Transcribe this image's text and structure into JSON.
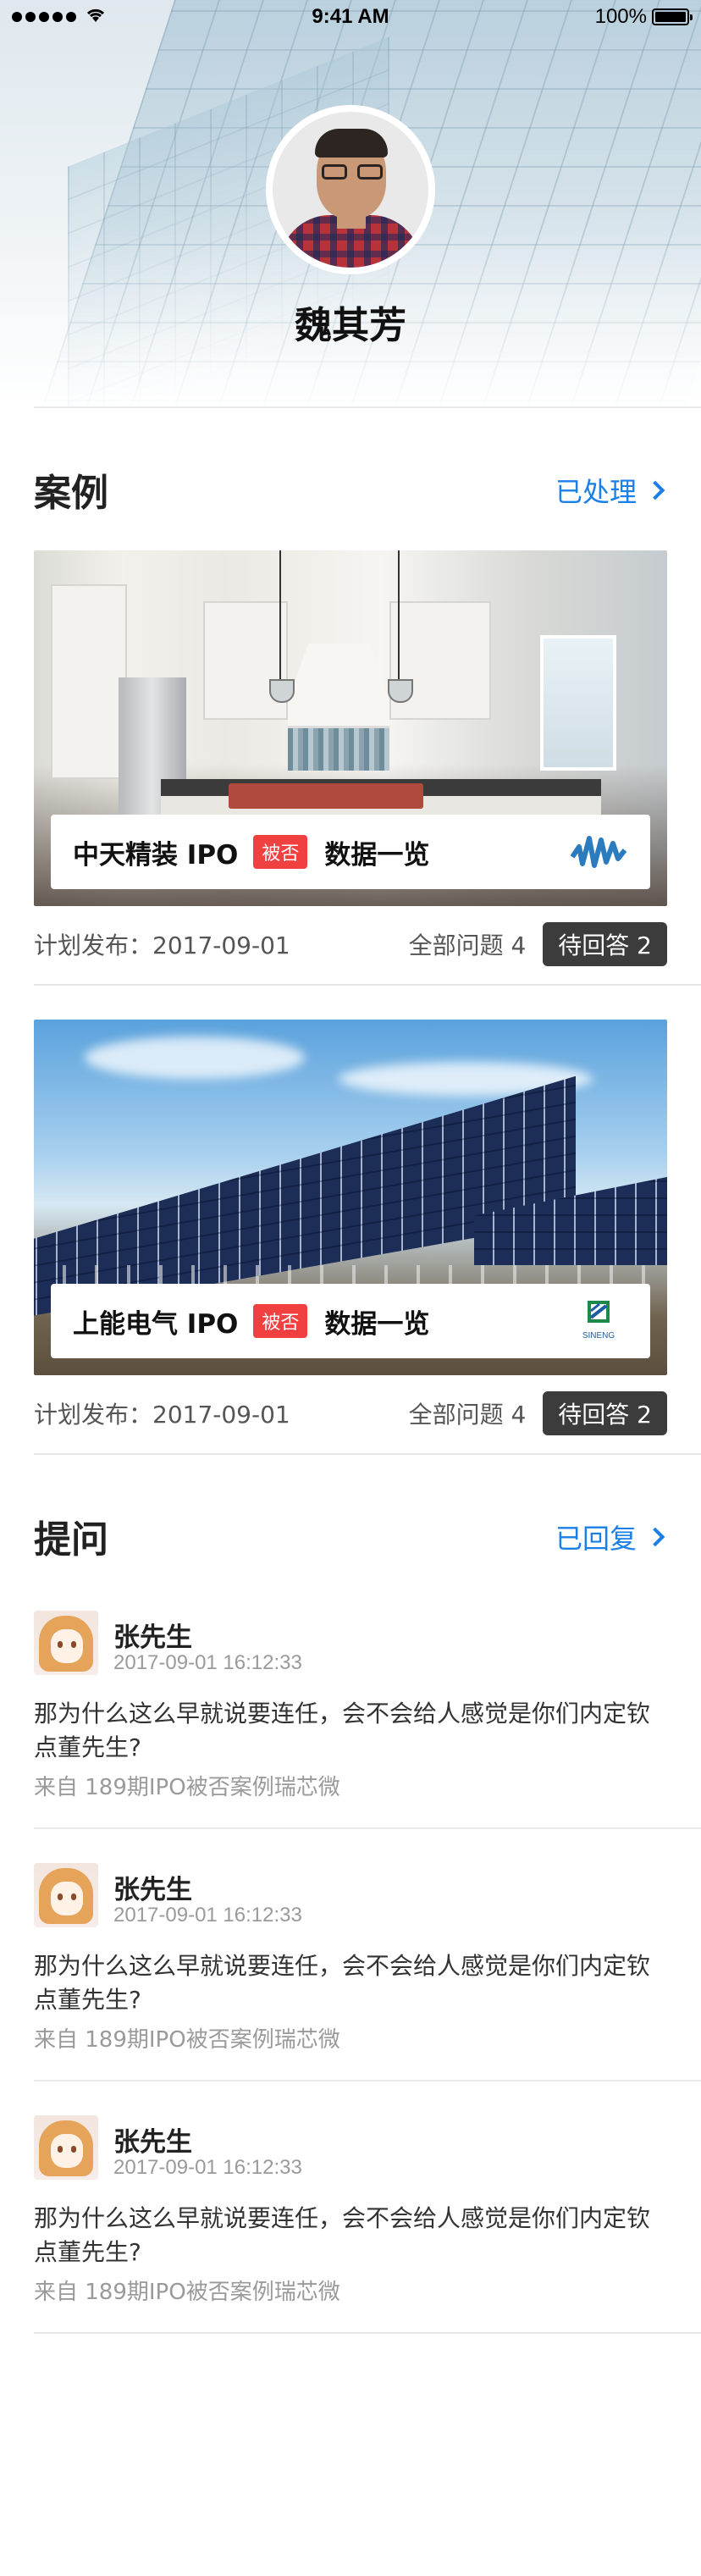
{
  "status_bar": {
    "time": "9:41 AM",
    "battery": "100%"
  },
  "profile": {
    "name": "魏其芳"
  },
  "cases_section": {
    "title": "案例",
    "link_label": "已处理",
    "cards": [
      {
        "name": "中天精装 IPO",
        "badge": "被否",
        "subtitle": "数据一览",
        "plan_date": "计划发布：2017-09-01",
        "total_questions": "全部问题 4",
        "pending": "待回答 2"
      },
      {
        "name": "上能电气 IPO",
        "badge": "被否",
        "subtitle": "数据一览",
        "plan_date": "计划发布：2017-09-01",
        "total_questions": "全部问题 4",
        "pending": "待回答 2",
        "logo_text": "SINENG"
      }
    ]
  },
  "questions_section": {
    "title": "提问",
    "link_label": "已回复",
    "items": [
      {
        "user": "张先生",
        "time": "2017-09-01 16:12:33",
        "text": "那为什么这么早就说要连任，会不会给人感觉是你们内定钦点董先生?",
        "source": "来自 189期IPO被否案例瑞芯微"
      },
      {
        "user": "张先生",
        "time": "2017-09-01 16:12:33",
        "text": "那为什么这么早就说要连任，会不会给人感觉是你们内定钦点董先生?",
        "source": "来自 189期IPO被否案例瑞芯微"
      },
      {
        "user": "张先生",
        "time": "2017-09-01 16:12:33",
        "text": "那为什么这么早就说要连任，会不会给人感觉是你们内定钦点董先生?",
        "source": "来自 189期IPO被否案例瑞芯微"
      }
    ]
  },
  "colors": {
    "accent": "#1a7fe6",
    "badge": "#f04040",
    "pending_bg": "#3c3c3c"
  },
  "icons": [
    "signal-icon",
    "wifi-icon",
    "battery-icon",
    "chevron-right-icon",
    "case-logo-icon",
    "sineng-logo-icon"
  ]
}
